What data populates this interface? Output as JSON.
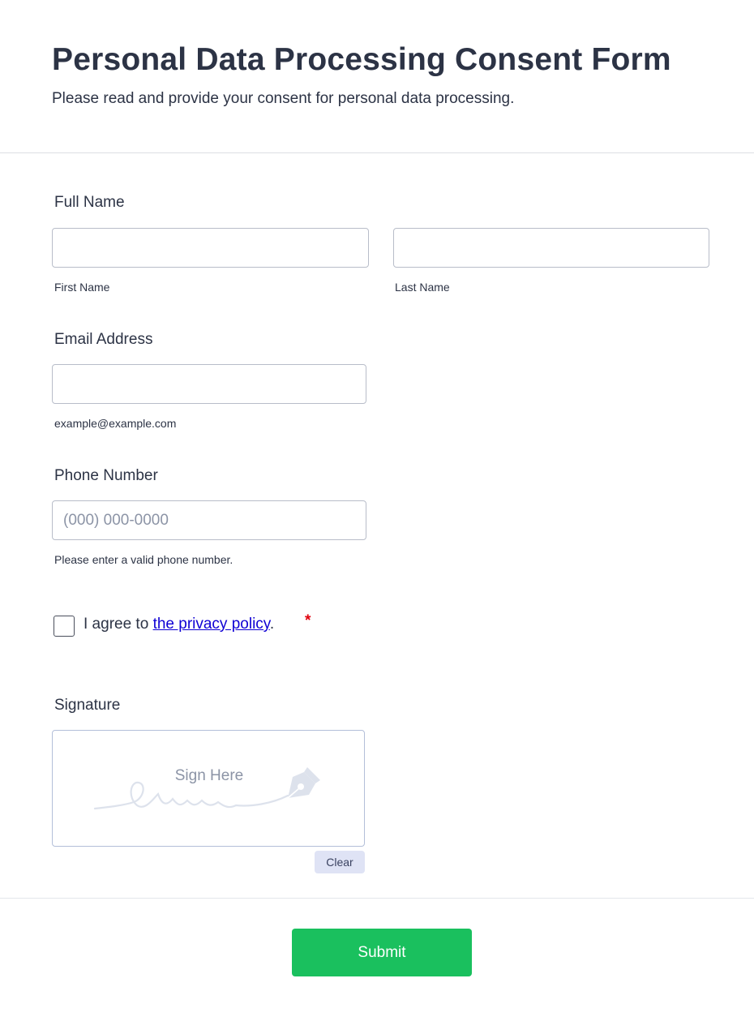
{
  "header": {
    "title": "Personal Data Processing Consent Form",
    "subtitle": "Please read and provide your consent for personal data processing."
  },
  "full_name": {
    "label": "Full Name",
    "first_name": {
      "value": "",
      "sublabel": "First Name"
    },
    "last_name": {
      "value": "",
      "sublabel": "Last Name"
    }
  },
  "email": {
    "label": "Email Address",
    "value": "",
    "sublabel": "example@example.com"
  },
  "phone": {
    "label": "Phone Number",
    "value": "",
    "placeholder": "(000) 000-0000",
    "sublabel": "Please enter a valid phone number."
  },
  "consent": {
    "text_before": "I agree to ",
    "link_text": "the privacy policy",
    "text_after": ".",
    "required_marker": "*",
    "checked": false
  },
  "signature": {
    "label": "Signature",
    "prompt": "Sign Here",
    "icon": "pen-nib-icon",
    "clear_label": "Clear"
  },
  "submit": {
    "label": "Submit"
  },
  "colors": {
    "text": "#2c3345",
    "submit": "#1ac05e",
    "link": "#0f00d4",
    "required": "#e0000d",
    "clear_bg": "#dfe3f5"
  }
}
